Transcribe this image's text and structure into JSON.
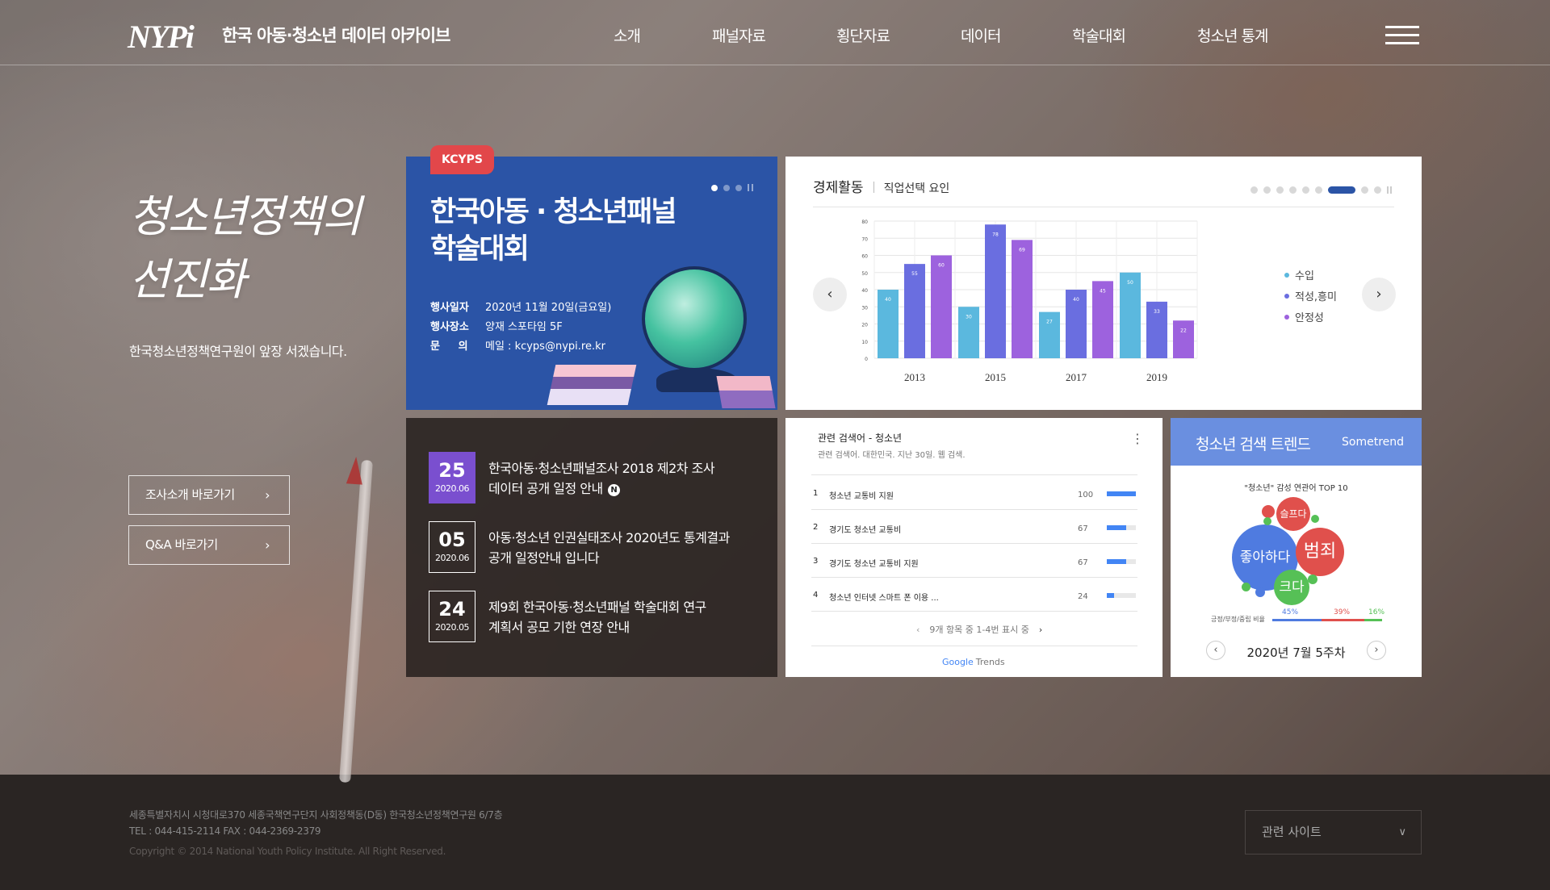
{
  "header": {
    "logo": "NYPi",
    "site_title": "한국 아동·청소년 데이터 아카이브",
    "nav": [
      "소개",
      "패널자료",
      "횡단자료",
      "데이터",
      "학술대회",
      "청소년 통계"
    ]
  },
  "intro": {
    "slogan_line1": "청소년정책의",
    "slogan_line2": "선진화",
    "subtitle": "한국청소년정책연구원이 앞장 서겠습니다.",
    "buttons": [
      "조사소개 바로가기",
      "Q&A 바로가기"
    ]
  },
  "kcyps": {
    "badge": "KCYPS",
    "title_line1": "한국아동 · 청소년패널",
    "title_line2": "학술대회",
    "info": [
      {
        "key": "행사일자",
        "value": "2020년 11월 20일(금요일)"
      },
      {
        "key": "행사장소",
        "value": "양재 스포타임 5F"
      },
      {
        "key": "문     의",
        "value": "메일 : kcyps@nypi.re.kr"
      }
    ]
  },
  "economy": {
    "title": "경제활동",
    "subtitle": "직업선택 요인"
  },
  "chart_data": {
    "type": "bar",
    "categories": [
      "2013",
      "2015",
      "2017",
      "2019"
    ],
    "series": [
      {
        "name": "수입",
        "values": [
          40,
          30,
          27,
          50
        ],
        "color": "#5bb8de"
      },
      {
        "name": "적성,흥미",
        "values": [
          55,
          78,
          40,
          33
        ],
        "color": "#6a6ee0"
      },
      {
        "name": "안정성",
        "values": [
          60,
          69,
          45,
          22
        ],
        "color": "#9d62de"
      }
    ],
    "ylim": [
      0,
      80
    ],
    "yticks": [
      0,
      10,
      20,
      30,
      40,
      50,
      60,
      70,
      80
    ],
    "grid": true,
    "legend": "right"
  },
  "notices": [
    {
      "day": "25",
      "ym": "2020.06",
      "line1": "한국아동·청소년패널조사 2018 제2차 조사",
      "line2": "데이터 공개 일정 안내",
      "new": "N"
    },
    {
      "day": "05",
      "ym": "2020.06",
      "line1": "아동·청소년 인권실태조사 2020년도 통계결과",
      "line2": "공개 일정안내 입니다",
      "new": ""
    },
    {
      "day": "24",
      "ym": "2020.05",
      "line1": "제9회 한국아동·청소년패널 학술대회 연구",
      "line2": "계획서 공모 기한 연장 안내",
      "new": ""
    }
  ],
  "google_trends": {
    "title": "관련 검색어 - 청소년",
    "subtitle": "관련 검색어. 대한민국. 지난 30일. 웹 검색.",
    "rows": [
      {
        "rank": "1",
        "term": "청소년 교통비 지원",
        "value": 100
      },
      {
        "rank": "2",
        "term": "경기도 청소년 교통비",
        "value": 67
      },
      {
        "rank": "3",
        "term": "경기도 청소년 교통비 지원",
        "value": 67
      },
      {
        "rank": "4",
        "term": "청소년 인터넷 스마트 폰 이용 ...",
        "value": 24
      }
    ],
    "pager": "9개 항목 중 1-4번 표시 중",
    "logo_google": "Google",
    "logo_trends": "Trends"
  },
  "sometrend": {
    "title": "청소년 검색 트렌드",
    "brand": "Sometrend",
    "caption": "\"청소년\" 감성 연관어 TOP 10",
    "bubbles": [
      {
        "label": "좋아하다",
        "color": "#4f7be0"
      },
      {
        "label": "범죄",
        "color": "#e0504c"
      },
      {
        "label": "크다",
        "color": "#56c056"
      },
      {
        "label": "슬프다",
        "color": "#e0504c"
      }
    ],
    "sentiment_label": "긍정/부정/중립 비율",
    "sentiment": [
      {
        "pct": "45%",
        "color": "#4f7be0"
      },
      {
        "pct": "39%",
        "color": "#e0504c"
      },
      {
        "pct": "16%",
        "color": "#56c056"
      }
    ],
    "week": "2020년 7월 5주차"
  },
  "footer": {
    "address": "세종특별자치시 시청대로370 세종국책연구단지 사회정책동(D동) 한국청소년정책연구원 6/7층",
    "tel": "TEL : 044-415-2114 FAX : 044-2369-2379",
    "copyright": "Copyright © 2014 National Youth Policy Institute. All Right Reserved.",
    "related_site": "관련 사이트"
  },
  "colors": {
    "accent_blue": "#2b54a6",
    "badge_red": "#e2474a",
    "date_active": "#7a4fcf",
    "sometrend_header": "#6a8fe0"
  }
}
